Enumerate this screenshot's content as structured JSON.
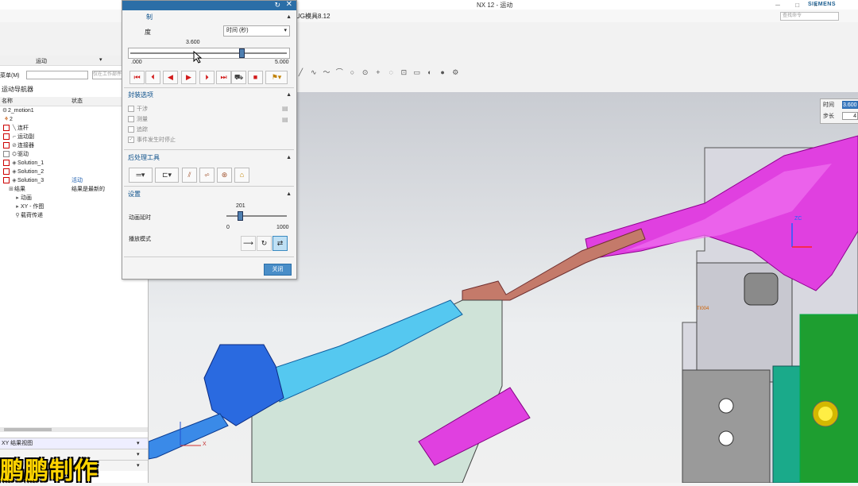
{
  "app": {
    "window_title": "NX 12 - 运动",
    "brand": "SIEMENS",
    "doc_tab": "UG模具8.12",
    "search_placeholder": "查找命令"
  },
  "navigator": {
    "ribbon_item": "运动",
    "title": "运动导航器",
    "col_name": "名称",
    "col_status": "状态",
    "menu_label": "菜单(M)",
    "filter_placeholder": "仅在工作部件内",
    "rows": [
      {
        "label": "2_motion1",
        "status": "",
        "extra": ""
      },
      {
        "label": "2",
        "status": "",
        "extra": ""
      },
      {
        "label": "连杆",
        "status": "",
        "extra": ""
      },
      {
        "label": "运动副",
        "status": "",
        "extra": ""
      },
      {
        "label": "连接器",
        "status": "",
        "extra": ""
      },
      {
        "label": "驱动",
        "status": "",
        "extra": ""
      },
      {
        "label": "Solution_1",
        "status": "",
        "extra": "S"
      },
      {
        "label": "Solution_2",
        "status": "",
        "extra": "S"
      },
      {
        "label": "Solution_3",
        "status": "活动",
        "extra": "S"
      },
      {
        "label": "结果",
        "status": "结果是最新的",
        "extra": ""
      },
      {
        "label": "动画",
        "status": "",
        "extra": ""
      },
      {
        "label": "XY - 作图",
        "status": "",
        "extra": ""
      },
      {
        "label": "载荷传递",
        "status": "",
        "extra": ""
      }
    ],
    "bottom_panel_1": "XY 结果视图"
  },
  "dialog": {
    "section_animation": "动画控制",
    "section_animation_short": "制",
    "time_label": "度",
    "time_select": "时间 (秒)",
    "time_value": "3.600",
    "range_min": ".000",
    "range_max": "5.000",
    "time_fraction": 0.72,
    "section_package": "封装选项",
    "opts": [
      "干涉",
      "测量",
      "追踪",
      "事件发生时停止"
    ],
    "section_post": "后处理工具",
    "section_settings": "设置",
    "anim_delay_label": "动画延时",
    "anim_delay_value": "201",
    "anim_delay_min": "0",
    "anim_delay_max": "1000",
    "anim_delay_fraction": 0.201,
    "play_mode_label": "播放模式",
    "close_button": "关闭"
  },
  "viewport": {
    "time_label": "时间",
    "time_value": "3.600",
    "step_label": "步长",
    "step_value": "4",
    "csys_label": "ZC",
    "xaxis_label": "X",
    "small_label": "TI004"
  },
  "watermark": "鹏鹏制作"
}
